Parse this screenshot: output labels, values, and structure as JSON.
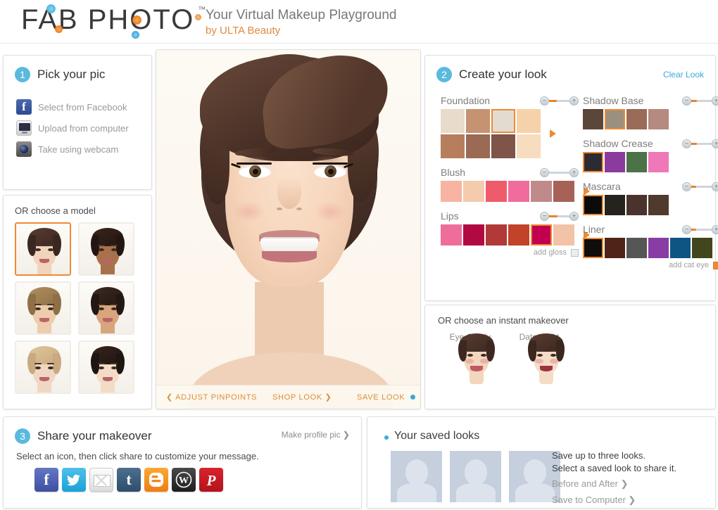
{
  "header": {
    "logo": "FAB PHOTO",
    "trademark": "™",
    "tagline_1": "Your Virtual Makeup Playground",
    "tagline_2": "by ULTA Beauty"
  },
  "pick": {
    "step_number": "1",
    "title": "Pick your pic",
    "options": [
      {
        "label": "Select from Facebook",
        "icon": "facebook-icon"
      },
      {
        "label": "Upload from computer",
        "icon": "computer-icon"
      },
      {
        "label": "Take using webcam",
        "icon": "webcam-icon"
      }
    ]
  },
  "models": {
    "title": "OR choose a model",
    "items": [
      {
        "name": "model-1",
        "selected": true,
        "skin": "#f2d3bb",
        "hair": "#3a2721",
        "hair2": "#5a3d30"
      },
      {
        "name": "model-2",
        "selected": false,
        "skin": "#a9714b",
        "hair": "#231612",
        "hair2": "#3b241c"
      },
      {
        "name": "model-3",
        "selected": false,
        "skin": "#edcdab",
        "hair": "#8f6f46",
        "hair2": "#b08f60"
      },
      {
        "name": "model-4",
        "selected": false,
        "skin": "#d8a57c",
        "hair": "#241713",
        "hair2": "#3d2a22"
      },
      {
        "name": "model-5",
        "selected": false,
        "skin": "#f0d7c2",
        "hair": "#c9a97f",
        "hair2": "#e0c69c"
      },
      {
        "name": "model-6",
        "selected": false,
        "skin": "#f3dcc6",
        "hair": "#1f1512",
        "hair2": "#37241d"
      }
    ]
  },
  "photo": {
    "actions": {
      "adjust": "❮ ADJUST PINPOINTS",
      "shop": "SHOP LOOK ❯",
      "save": "SAVE LOOK"
    }
  },
  "look": {
    "step_number": "2",
    "title": "Create your look",
    "clear_label": "Clear Look",
    "groups_left": [
      {
        "name": "Foundation",
        "slider": 42,
        "layout": "two-rows",
        "swatch_size": "lg",
        "has_arrow": true,
        "swatches": [
          {
            "color": "#e8dbcb",
            "selected": false
          },
          {
            "color": "#c59372",
            "selected": false
          },
          {
            "color": "#e3dbd0",
            "selected": true
          },
          {
            "color": "#f6d2ab",
            "selected": false
          },
          {
            "color": "#b77e5d",
            "selected": false
          },
          {
            "color": "#9b6a54",
            "selected": false
          },
          {
            "color": "#7e5548",
            "selected": false
          },
          {
            "color": "#f7dcc0",
            "selected": false
          }
        ]
      },
      {
        "name": "Blush",
        "slider": 0,
        "layout": "one-row",
        "swatch_size": "sm",
        "has_arrow": true,
        "swatches": [
          {
            "color": "#f7b4a2",
            "selected": false
          },
          {
            "color": "#f4cbad",
            "selected": false
          },
          {
            "color": "#ee5c6b",
            "selected": false
          },
          {
            "color": "#ef6c9c",
            "selected": false
          },
          {
            "color": "#c08a8a",
            "selected": false
          },
          {
            "color": "#a76257",
            "selected": false
          }
        ]
      },
      {
        "name": "Lips",
        "slider": 45,
        "layout": "one-row",
        "swatch_size": "sm",
        "has_arrow": true,
        "add_label": "add gloss",
        "add_checked": false,
        "swatches": [
          {
            "color": "#ee6e9b",
            "selected": false
          },
          {
            "color": "#b10a43",
            "selected": false
          },
          {
            "color": "#b13a39",
            "selected": false
          },
          {
            "color": "#c2432a",
            "selected": false
          },
          {
            "color": "#c2004f",
            "selected": true
          },
          {
            "color": "#f2c3a8",
            "selected": false
          }
        ]
      }
    ],
    "groups_right": [
      {
        "name": "Shadow Base",
        "slider": 35,
        "layout": "one-row",
        "swatch_size": "xs",
        "has_arrow": false,
        "swatches": [
          {
            "color": "#5b463a",
            "selected": false
          },
          {
            "color": "#9b907f",
            "selected": true
          },
          {
            "color": "#9a6b57",
            "selected": false
          },
          {
            "color": "#b58a80",
            "selected": false
          }
        ]
      },
      {
        "name": "Shadow Crease",
        "slider": 35,
        "layout": "one-row",
        "swatch_size": "xs",
        "has_arrow": false,
        "swatches": [
          {
            "color": "#2c2b33",
            "selected": true
          },
          {
            "color": "#8b3b9d",
            "selected": false
          },
          {
            "color": "#4c7348",
            "selected": false
          },
          {
            "color": "#ee78b8",
            "selected": false
          }
        ]
      },
      {
        "name": "Mascara",
        "slider": 32,
        "layout": "one-row",
        "swatch_size": "xs",
        "has_arrow": false,
        "swatches": [
          {
            "color": "#0d0b09",
            "selected": true
          },
          {
            "color": "#26231f",
            "selected": false
          },
          {
            "color": "#4b322c",
            "selected": false
          },
          {
            "color": "#4f3a2b",
            "selected": false
          }
        ]
      },
      {
        "name": "Liner",
        "slider": 32,
        "layout": "one-row",
        "swatch_size": "xs",
        "has_arrow": false,
        "add_label": "add cat eye",
        "add_checked": true,
        "swatches": [
          {
            "color": "#110d0a",
            "selected": true
          },
          {
            "color": "#4f2418",
            "selected": false
          },
          {
            "color": "#565656",
            "selected": false
          },
          {
            "color": "#8a3ca5",
            "selected": false
          },
          {
            "color": "#0e5583",
            "selected": false
          },
          {
            "color": "#41461c",
            "selected": false
          }
        ]
      }
    ]
  },
  "instant": {
    "title": "OR choose  an instant makeover",
    "items": [
      {
        "label": "Eye Candy",
        "skin": "#f3d6be",
        "hair": "#3c2820",
        "lip": "#c05a61"
      },
      {
        "label": "Date Night",
        "skin": "#f5dcc6",
        "hair": "#3a2720",
        "lip": "#9c3340"
      }
    ]
  },
  "share": {
    "step_number": "3",
    "title": "Share your makeover",
    "make_profile": "Make profile pic ❯",
    "subtitle": "Select an icon, then click share to customize your message.",
    "socials": [
      {
        "name": "facebook-share-icon",
        "glyph": "f",
        "class": "soc-fb"
      },
      {
        "name": "twitter-share-icon",
        "glyph": "",
        "class": "soc-tw"
      },
      {
        "name": "email-share-icon",
        "glyph": "",
        "class": "soc-em"
      },
      {
        "name": "tumblr-share-icon",
        "glyph": "t",
        "class": "soc-tu"
      },
      {
        "name": "blogger-share-icon",
        "glyph": "b",
        "class": "soc-bl"
      },
      {
        "name": "wordpress-share-icon",
        "glyph": "W",
        "class": "soc-wp"
      },
      {
        "name": "pinterest-share-icon",
        "glyph": "P",
        "class": "soc-pi"
      }
    ]
  },
  "saved": {
    "title": "Your saved looks",
    "slots": 3,
    "line_1": "Save up to three looks.",
    "line_2": "Select a saved look to share it.",
    "link_1": "Before and After ❯",
    "link_2": "Save to Computer ❯"
  },
  "colors": {
    "accent_orange": "#ef8a33",
    "accent_blue": "#3aa9dc",
    "step_badge": "#5ab9dd",
    "link_gray": "#9a9a9a"
  }
}
